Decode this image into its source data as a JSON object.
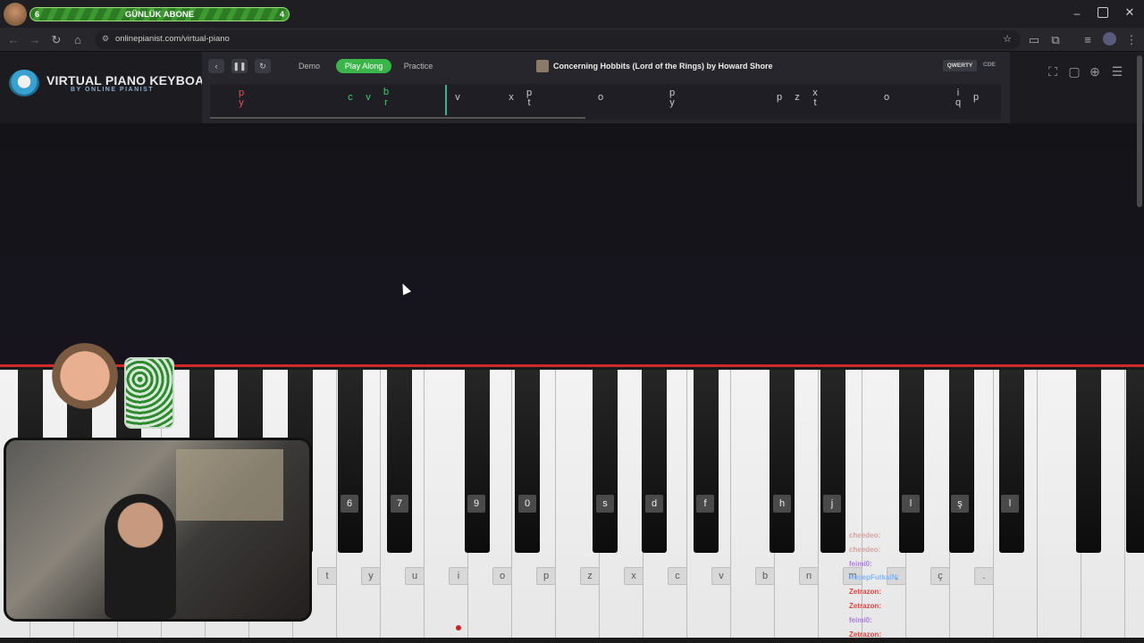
{
  "overlay": {
    "sub_left": "6",
    "sub_title": "GÜNLÜK ABONE",
    "sub_right": "4"
  },
  "browser": {
    "url": "onlinepianist.com/virtual-piano",
    "back_icon": "arrow-left",
    "forward_icon": "arrow-right",
    "reload_icon": "reload",
    "home_icon": "home",
    "star_icon": "star"
  },
  "site": {
    "logo_title": "VIRTUAL PIANO KEYBOARD",
    "logo_sub": "BY ONLINE PIANIST"
  },
  "player": {
    "modes": [
      "Demo",
      "Play Along",
      "Practice"
    ],
    "active_mode": "Play Along",
    "song_title": "Concerning Hobbits (Lord of the Rings) by Howard Shore",
    "layout_active": "QWERTY",
    "layout_other": "CDE",
    "accent": "#3bb54a"
  },
  "sheet": {
    "notes": [
      {
        "t": "p",
        "color": "#e05555"
      },
      {
        "t": "y",
        "color": "#e05555"
      },
      {
        "t": "c",
        "color": "#3bd36a"
      },
      {
        "t": "v",
        "color": "#3bd36a"
      },
      {
        "t": "b",
        "color": "#3bd36a"
      },
      {
        "t": "r",
        "color": "#3bd36a"
      },
      {
        "t": "v",
        "color": "#cfcfcf"
      },
      {
        "t": "x",
        "color": "#cfcfcf"
      },
      {
        "t": "p",
        "color": "#cfcfcf"
      },
      {
        "t": "t",
        "color": "#cfcfcf"
      },
      {
        "t": "o",
        "color": "#cfcfcf"
      },
      {
        "t": "p",
        "color": "#cfcfcf"
      },
      {
        "t": "y",
        "color": "#cfcfcf"
      },
      {
        "t": "p",
        "color": "#cfcfcf"
      },
      {
        "t": "z",
        "color": "#cfcfcf"
      },
      {
        "t": "x",
        "color": "#cfcfcf"
      },
      {
        "t": "t",
        "color": "#cfcfcf"
      },
      {
        "t": "o",
        "color": "#cfcfcf"
      },
      {
        "t": "i",
        "color": "#cfcfcf"
      },
      {
        "t": "q",
        "color": "#cfcfcf"
      },
      {
        "t": "p",
        "color": "#cfcfcf"
      }
    ]
  },
  "piano": {
    "black_labels": [
      "6",
      "7",
      "9",
      "0",
      "s",
      "d",
      "f",
      "h",
      "j",
      "l",
      "ş",
      "l"
    ],
    "white_labels": [
      "t",
      "y",
      "u",
      "i",
      "o",
      "p",
      "z",
      "x",
      "c",
      "v",
      "b",
      "n",
      "m",
      ",",
      "ç",
      "."
    ]
  },
  "chat": [
    {
      "name": "cheedeo:",
      "color": "#d9a0a0"
    },
    {
      "name": "cheedeo:",
      "color": "#d9a0a0"
    },
    {
      "name": "feimi0:",
      "color": "#b07be0"
    },
    {
      "name": "RecepFutkaiN:",
      "color": "#7fb5ff"
    },
    {
      "name": "Zetrazon:",
      "color": "#e04040"
    },
    {
      "name": "Zetrazon:",
      "color": "#e04040"
    },
    {
      "name": "feimi0:",
      "color": "#b07be0"
    },
    {
      "name": "Zetrazon:",
      "color": "#e04040"
    }
  ]
}
